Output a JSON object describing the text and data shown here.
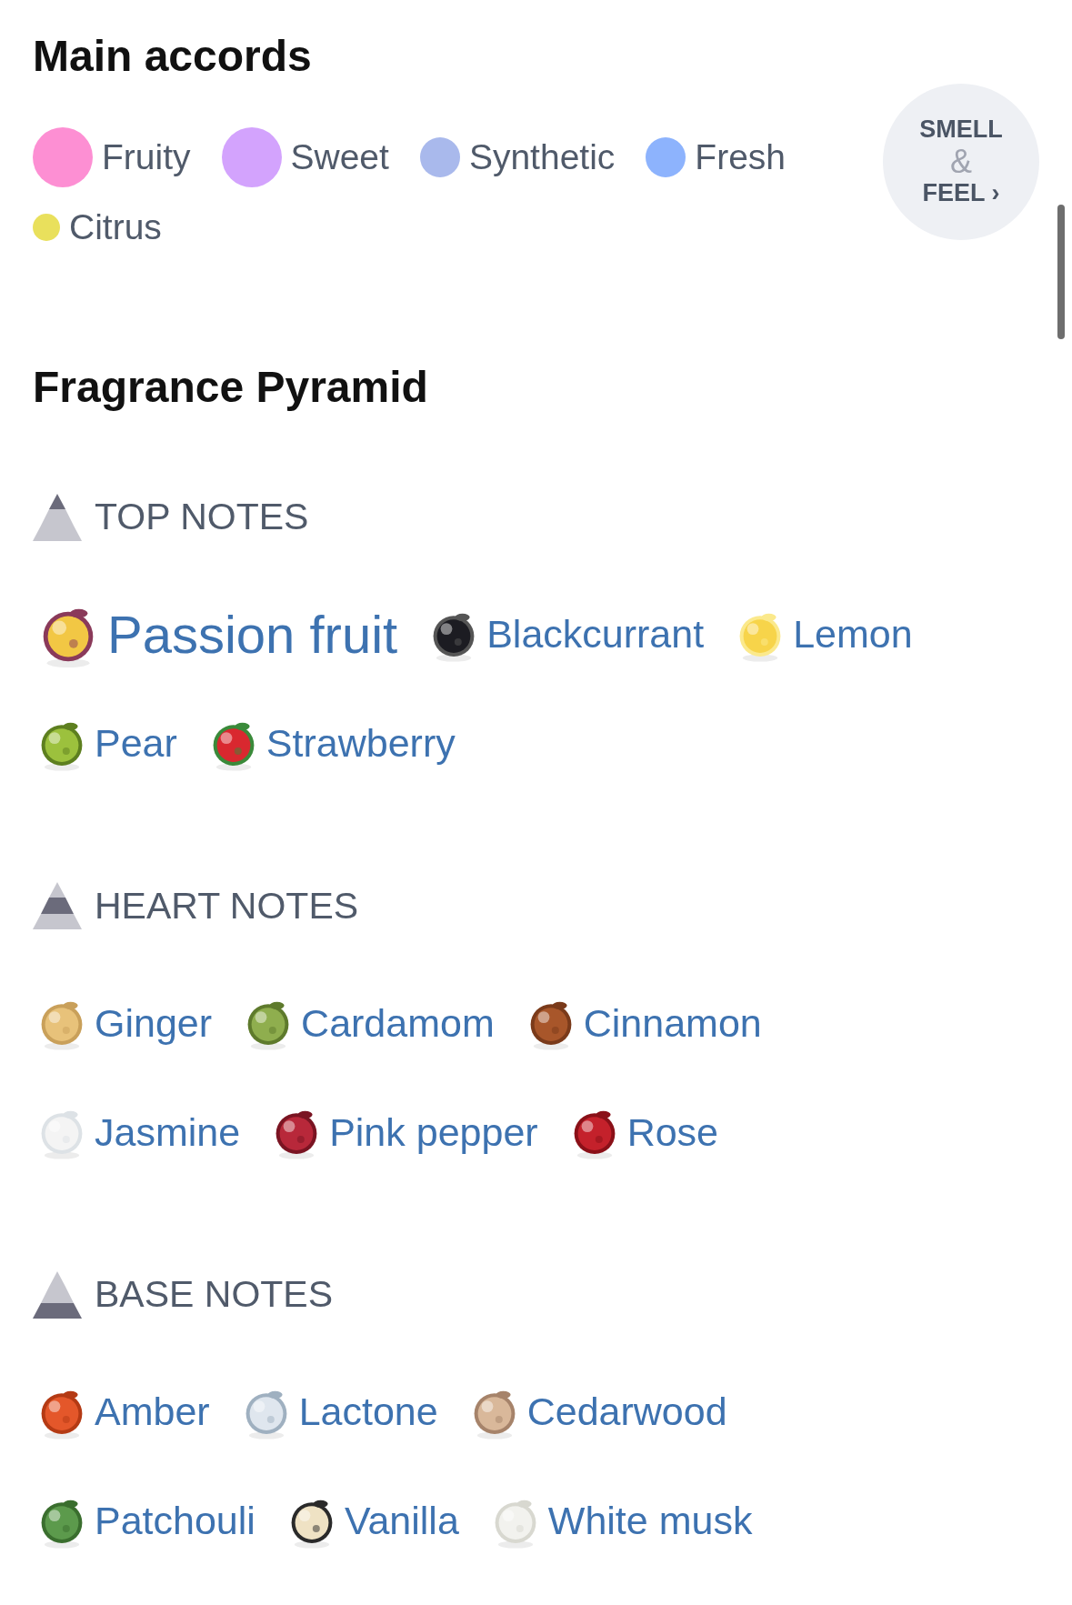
{
  "main_accords": {
    "title": "Main accords",
    "accords": [
      {
        "name": "Fruity",
        "color": "#fd8fd3",
        "kind": "large"
      },
      {
        "name": "Sweet",
        "color": "#d3a3fd",
        "kind": "large"
      },
      {
        "name": "Synthetic",
        "color": "#a9b9ec",
        "kind": "medium"
      },
      {
        "name": "Fresh",
        "color": "#8db3fd",
        "kind": "medium"
      },
      {
        "name": "Citrus",
        "color": "#e9e05c",
        "kind": "small"
      }
    ],
    "smell_feel_button": {
      "line_1": "SMELL",
      "ampersand": "&",
      "line_2": "FEEL",
      "chevron": "›"
    }
  },
  "fragrance_pyramid": {
    "title": "Fragrance Pyramid",
    "sections": [
      {
        "kind": "top",
        "heading": "TOP NOTES",
        "rows": [
          {
            "notes": [
              {
                "name": "Passion fruit",
                "kind": "large"
              },
              {
                "name": "Blackcurrant",
                "kind": "normal"
              },
              {
                "name": "Lemon",
                "kind": "normal"
              }
            ]
          },
          {
            "notes": [
              {
                "name": "Pear",
                "kind": "normal"
              },
              {
                "name": "Strawberry",
                "kind": "normal"
              }
            ]
          }
        ]
      },
      {
        "kind": "heart",
        "heading": "HEART NOTES",
        "rows": [
          {
            "notes": [
              {
                "name": "Ginger",
                "kind": "normal"
              },
              {
                "name": "Cardamom",
                "kind": "normal"
              },
              {
                "name": "Cinnamon",
                "kind": "normal"
              }
            ]
          },
          {
            "notes": [
              {
                "name": "Jasmine",
                "kind": "normal"
              },
              {
                "name": "Pink pepper",
                "kind": "normal"
              },
              {
                "name": "Rose",
                "kind": "normal"
              }
            ]
          }
        ]
      },
      {
        "kind": "base",
        "heading": "BASE NOTES",
        "rows": [
          {
            "notes": [
              {
                "name": "Amber",
                "kind": "normal"
              },
              {
                "name": "Lactone",
                "kind": "normal"
              },
              {
                "name": "Cedarwood",
                "kind": "normal"
              }
            ]
          },
          {
            "notes": [
              {
                "name": "Patchouli",
                "kind": "normal"
              },
              {
                "name": "Vanilla",
                "kind": "normal"
              },
              {
                "name": "White musk",
                "kind": "normal"
              }
            ]
          }
        ]
      }
    ]
  }
}
